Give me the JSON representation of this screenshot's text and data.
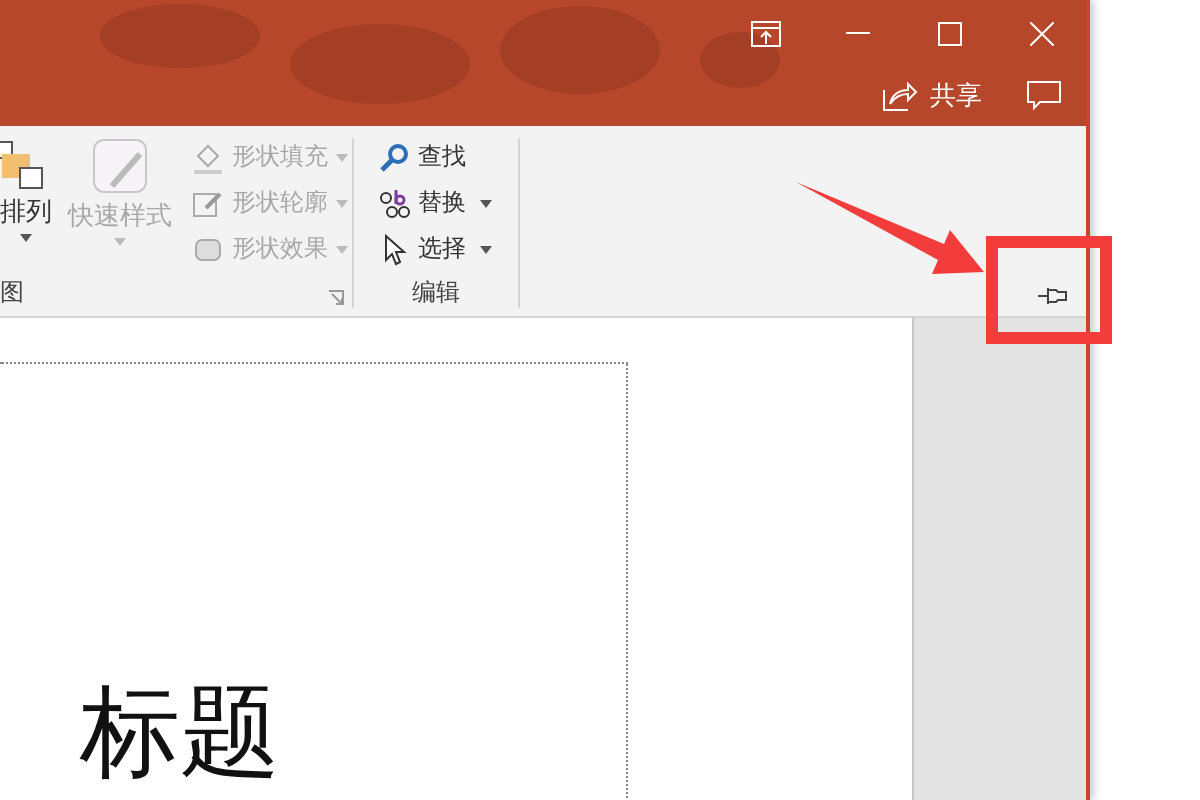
{
  "title_bar": {
    "share_button": {
      "label": "共享"
    }
  },
  "ribbon": {
    "drawing_group": {
      "label": "图",
      "arrange": {
        "label": "排列"
      },
      "quick_styles": {
        "label": "快速样式",
        "disabled": true
      },
      "shape_commands": [
        {
          "kind": "fill",
          "label": "形状填充",
          "disabled": true
        },
        {
          "kind": "outline",
          "label": "形状轮廓",
          "disabled": true
        },
        {
          "kind": "effects",
          "label": "形状效果",
          "disabled": true
        }
      ]
    },
    "editing_group": {
      "label": "编辑",
      "commands": [
        {
          "kind": "find",
          "label": "查找",
          "dropdown": false
        },
        {
          "kind": "replace",
          "label": "替换",
          "dropdown": true
        },
        {
          "kind": "select",
          "label": "选择",
          "dropdown": true
        }
      ]
    }
  },
  "slide": {
    "title": "标题"
  }
}
